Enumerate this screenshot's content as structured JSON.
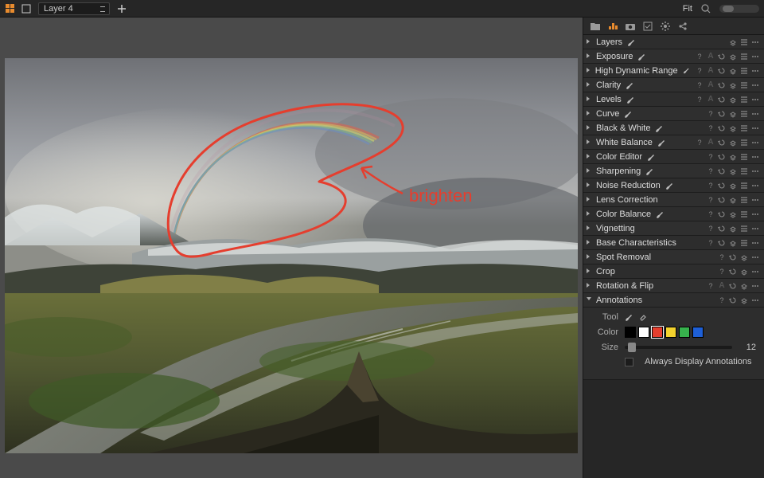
{
  "topbar": {
    "layer_label": "Layer 4",
    "fit_label": "Fit"
  },
  "side_tabs": [
    "library",
    "adjust",
    "capture",
    "preset",
    "settings",
    "share"
  ],
  "panels": [
    {
      "name": "Layers",
      "brush": true,
      "icons": [
        "copy",
        "menu",
        "more"
      ]
    },
    {
      "name": "Exposure",
      "brush": true,
      "icons": [
        "help",
        "A",
        "undo",
        "copy",
        "menu",
        "more"
      ]
    },
    {
      "name": "High Dynamic Range",
      "brush": true,
      "icons": [
        "help",
        "A",
        "undo",
        "copy",
        "menu",
        "more"
      ]
    },
    {
      "name": "Clarity",
      "brush": true,
      "icons": [
        "help",
        "A",
        "undo",
        "copy",
        "menu",
        "more"
      ]
    },
    {
      "name": "Levels",
      "brush": true,
      "icons": [
        "help",
        "A",
        "undo",
        "copy",
        "menu",
        "more"
      ]
    },
    {
      "name": "Curve",
      "brush": true,
      "icons": [
        "help",
        "undo",
        "copy",
        "menu",
        "more"
      ]
    },
    {
      "name": "Black & White",
      "brush": true,
      "icons": [
        "help",
        "undo",
        "copy",
        "menu",
        "more"
      ]
    },
    {
      "name": "White Balance",
      "brush": true,
      "icons": [
        "help",
        "A",
        "undo",
        "copy",
        "menu",
        "more"
      ]
    },
    {
      "name": "Color Editor",
      "brush": true,
      "icons": [
        "help",
        "undo",
        "copy",
        "menu",
        "more"
      ]
    },
    {
      "name": "Sharpening",
      "brush": true,
      "icons": [
        "help",
        "undo",
        "copy",
        "menu",
        "more"
      ]
    },
    {
      "name": "Noise Reduction",
      "brush": true,
      "icons": [
        "help",
        "undo",
        "copy",
        "menu",
        "more"
      ]
    },
    {
      "name": "Lens Correction",
      "brush": false,
      "icons": [
        "help",
        "undo",
        "copy",
        "menu",
        "more"
      ]
    },
    {
      "name": "Color Balance",
      "brush": true,
      "icons": [
        "help",
        "undo",
        "copy",
        "menu",
        "more"
      ]
    },
    {
      "name": "Vignetting",
      "brush": false,
      "icons": [
        "help",
        "undo",
        "copy",
        "menu",
        "more"
      ]
    },
    {
      "name": "Base Characteristics",
      "brush": false,
      "icons": [
        "help",
        "undo",
        "copy",
        "menu",
        "more"
      ]
    },
    {
      "name": "Spot Removal",
      "brush": false,
      "icons": [
        "help",
        "undo",
        "copy",
        "more"
      ]
    },
    {
      "name": "Crop",
      "brush": false,
      "icons": [
        "help",
        "undo",
        "copy",
        "more"
      ]
    },
    {
      "name": "Rotation & Flip",
      "brush": false,
      "icons": [
        "help",
        "A",
        "undo",
        "copy",
        "more"
      ]
    }
  ],
  "annotations": {
    "title": "Annotations",
    "icons": [
      "help",
      "undo",
      "copy",
      "more"
    ],
    "tool_label": "Tool",
    "color_label": "Color",
    "size_label": "Size",
    "colors": [
      "#000000",
      "#ffffff",
      "#e53e2e",
      "#f2d22e",
      "#37b24d",
      "#1e5fd6"
    ],
    "selected_color_index": 2,
    "size_value": "12",
    "always_label": "Always Display Annotations"
  },
  "annotation_overlay": {
    "note_text": "brighten"
  }
}
